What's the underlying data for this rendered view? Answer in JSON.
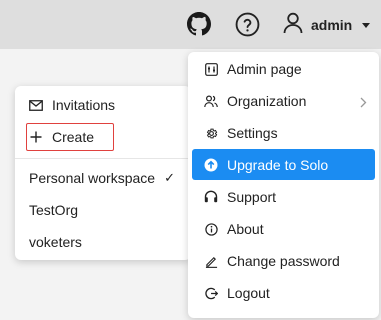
{
  "header": {
    "username": "admin",
    "github_icon": "github-icon",
    "help_icon": "help-circle-icon",
    "user_icon": "user-icon"
  },
  "workspace_menu": {
    "invitations": "Invitations",
    "create": "Create",
    "workspaces": [
      {
        "label": "Personal workspace",
        "selected": true
      },
      {
        "label": "TestOrg",
        "selected": false
      },
      {
        "label": "voketers",
        "selected": false
      }
    ],
    "check": "✓"
  },
  "user_menu": {
    "items": [
      {
        "label": "Admin page",
        "icon": "admin-panel-icon"
      },
      {
        "label": "Organization",
        "icon": "organization-icon"
      },
      {
        "label": "Settings",
        "icon": "gear-icon"
      },
      {
        "label": "Upgrade to Solo",
        "icon": "upgrade-arrow-icon",
        "highlighted": true
      },
      {
        "label": "Support",
        "icon": "headset-icon"
      },
      {
        "label": "About",
        "icon": "info-icon"
      },
      {
        "label": "Change password",
        "icon": "pencil-icon"
      },
      {
        "label": "Logout",
        "icon": "logout-icon"
      }
    ]
  },
  "colors": {
    "accent": "#1b8cf2",
    "highlight_border": "#e0413e",
    "topbar": "#dedede"
  }
}
